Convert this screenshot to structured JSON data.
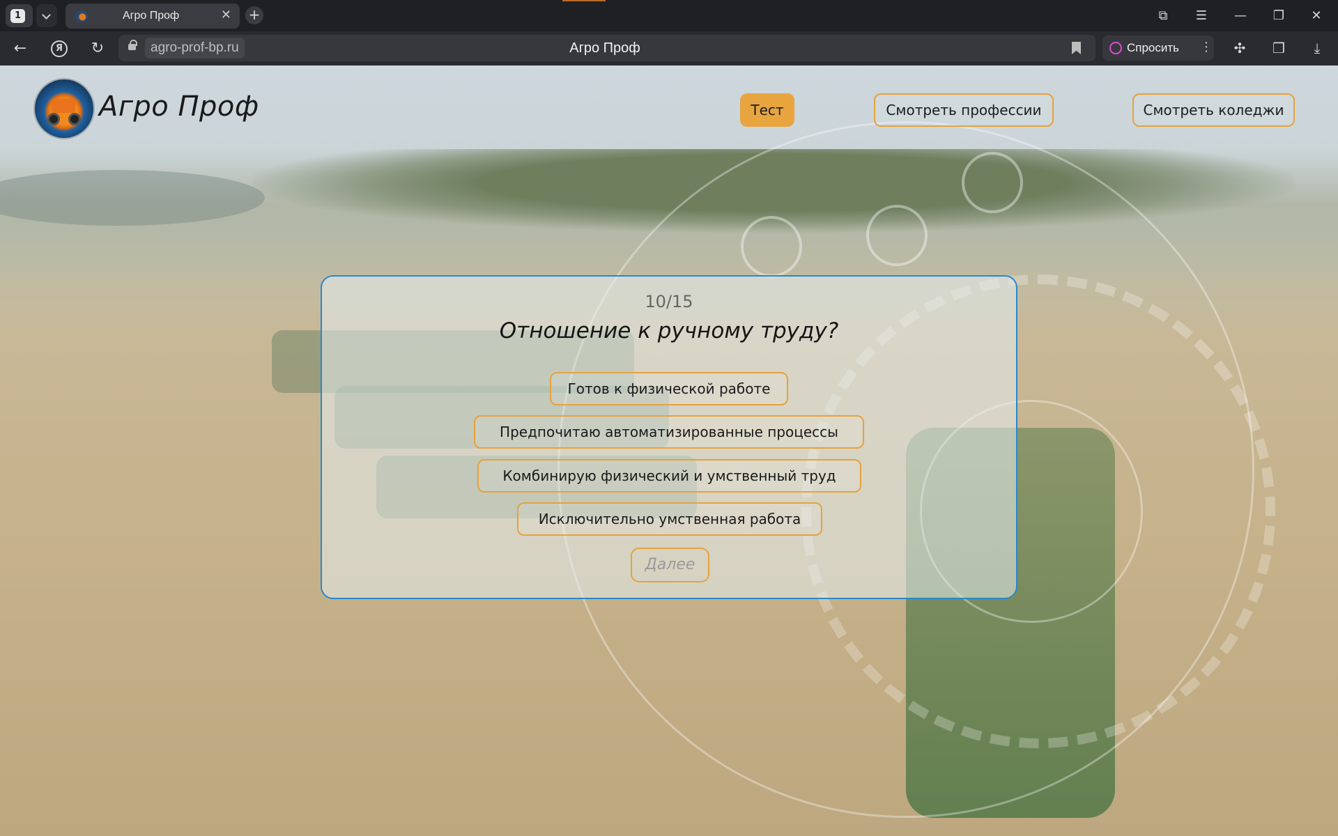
{
  "browser": {
    "tab_count": "1",
    "tab_title": "Агро Проф",
    "url": "agro-prof-bp.ru",
    "page_title": "Агро Проф",
    "ask_label": "Спросить"
  },
  "site": {
    "brand": "Агро Проф",
    "nav": {
      "test": "Тест",
      "professions": "Смотреть профессии",
      "colleges": "Смотреть коледжи"
    }
  },
  "quiz": {
    "progress": "10/15",
    "question": "Отношение к ручному труду?",
    "options": [
      "Готов к физической работе",
      "Предпочитаю автоматизированные процессы",
      "Комбинирую физический и умственный труд",
      "Исключительно умственная работа"
    ],
    "next_label": "Далее"
  },
  "colors": {
    "accent": "#e8a53f",
    "card_border": "#2a87c6"
  }
}
